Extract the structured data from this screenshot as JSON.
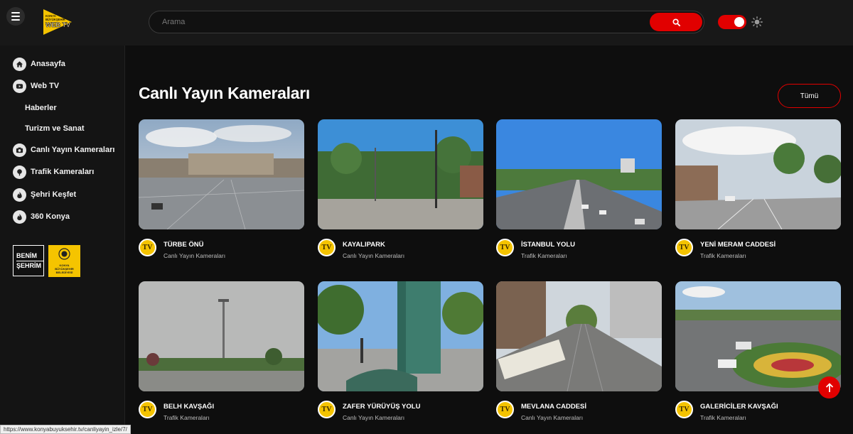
{
  "header": {
    "logo_text": "KONYA BÜYÜKŞEHİR WEB TV",
    "search_placeholder": "Arama"
  },
  "sidebar": {
    "items": [
      {
        "label": "Anasayfa",
        "icon": "home-icon"
      },
      {
        "label": "Web TV",
        "icon": "youtube-icon"
      },
      {
        "label": "Haberler"
      },
      {
        "label": "Turizm ve Sanat"
      },
      {
        "label": "Canlı Yayın Kameraları",
        "icon": "camera-icon"
      },
      {
        "label": "Trafik Kameraları",
        "icon": "traffic-light-icon"
      },
      {
        "label": "Şehri Keşfet",
        "icon": "flame-icon"
      },
      {
        "label": "360 Konya",
        "icon": "flame-icon"
      }
    ],
    "brand_benim": {
      "line1": "BENİM",
      "line2": "ŞEHRİM"
    },
    "brand_konya": {
      "line1": "KONYA",
      "line2": "BÜYÜKŞEHİR",
      "line3": "BELEDİYESİ"
    }
  },
  "main": {
    "title": "Canlı Yayın Kameraları",
    "all_label": "Tümü",
    "badge_text": "TV",
    "cards": [
      {
        "name": "TÜRBE ÖNÜ",
        "category": "Canlı Yayın Kameraları"
      },
      {
        "name": "KAYALIPARK",
        "category": "Canlı Yayın Kameraları"
      },
      {
        "name": "İSTANBUL YOLU",
        "category": "Trafik Kameraları"
      },
      {
        "name": "YENİ MERAM CADDESİ",
        "category": "Trafik Kameraları"
      },
      {
        "name": "BELH KAVŞAĞI",
        "category": "Trafik Kameraları"
      },
      {
        "name": "ZAFER YÜRÜYÜŞ YOLU",
        "category": "Canlı Yayın Kameraları"
      },
      {
        "name": "MEVLANA CADDESİ",
        "category": "Canlı Yayın Kameraları"
      },
      {
        "name": "GALERİCİLER KAVŞAĞI",
        "category": "Trafik Kameraları"
      }
    ]
  },
  "status_url": "https://www.konyabuyuksehir.tv/canliyayin_izle/7/",
  "colors": {
    "accent": "#e10000",
    "badge": "#f4c300",
    "background": "#0e0e0e"
  }
}
